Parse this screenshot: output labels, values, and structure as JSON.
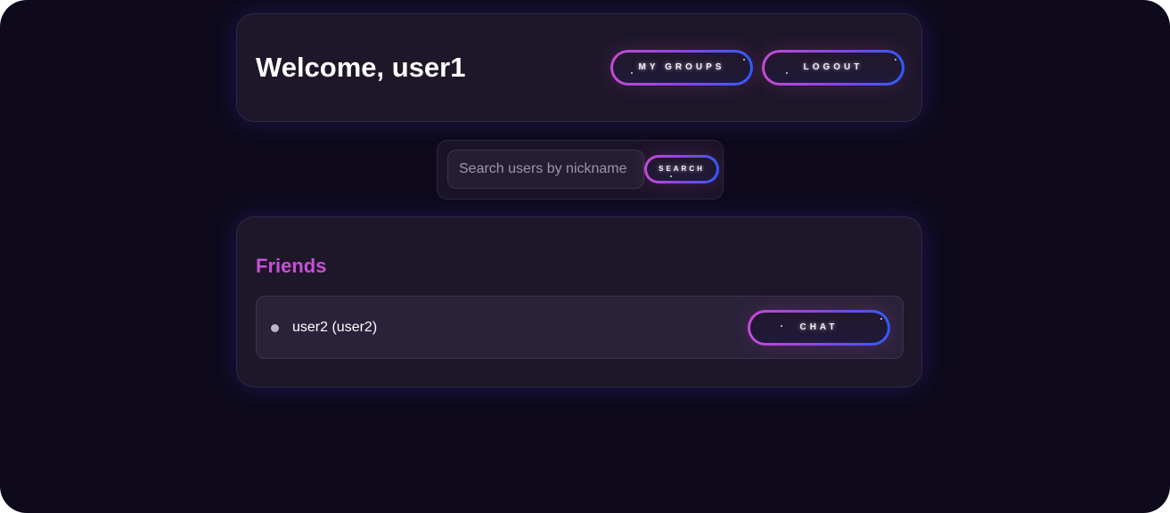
{
  "header": {
    "welcome_text": "Welcome, user1",
    "my_groups_label": "MY GROUPS",
    "logout_label": "LOGOUT"
  },
  "search": {
    "placeholder": "Search users by nickname",
    "value": "",
    "button_label": "SEARCH"
  },
  "friends": {
    "title": "Friends",
    "items": [
      {
        "name": "user2 (user2)",
        "status": "offline",
        "chat_label": "CHAT"
      }
    ]
  },
  "colors": {
    "background": "#0e0a1c",
    "card": "#1d1729",
    "accent_pink": "#c94fd6",
    "accent_blue": "#2f5bff",
    "status_offline": "#b9b5c3"
  }
}
